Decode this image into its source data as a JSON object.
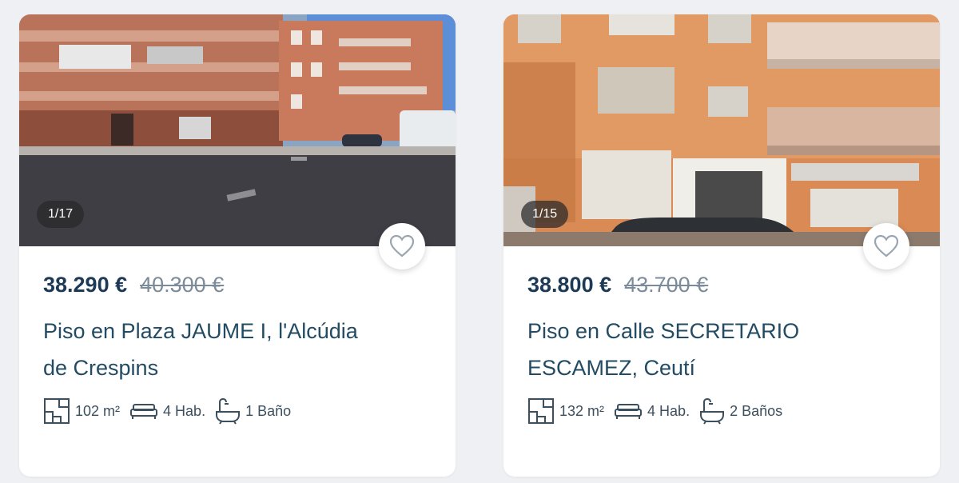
{
  "listings": [
    {
      "photo_counter": "1/17",
      "price": "38.290 €",
      "old_price": "40.300 €",
      "title_line1": "Piso en Plaza JAUME I, l'Alcúdia",
      "title_line2": "de Crespins",
      "area": "102 m²",
      "rooms": "4 Hab.",
      "baths": "1 Baño"
    },
    {
      "photo_counter": "1/15",
      "price": "38.800 €",
      "old_price": "43.700 €",
      "title_line1": "Piso en Calle SECRETARIO",
      "title_line2": "ESCAMEZ, Ceutí",
      "area": "132 m²",
      "rooms": "4 Hab.",
      "baths": "2 Baños"
    }
  ],
  "icons": {
    "favorite": "heart-icon",
    "area": "floorplan-icon",
    "rooms": "bed-icon",
    "baths": "bathtub-icon"
  },
  "colors": {
    "price": "#1d3b57",
    "title": "#234b63",
    "old_price": "#7c8b99"
  }
}
